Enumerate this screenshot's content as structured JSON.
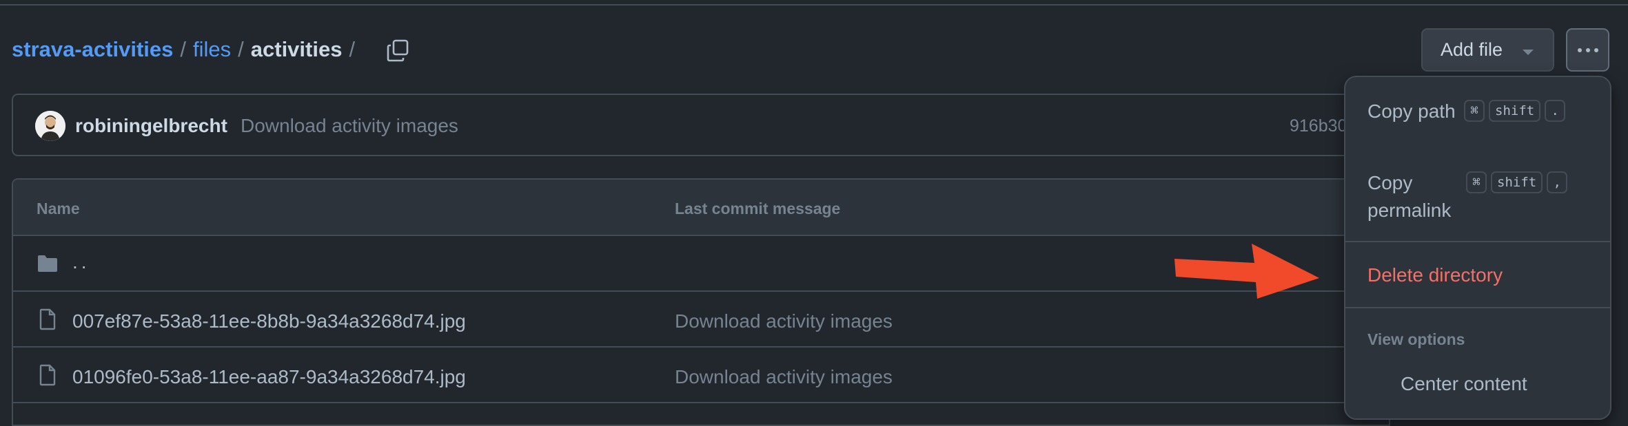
{
  "breadcrumb": {
    "repo": "strava-activities",
    "folder": "files",
    "current": "activities",
    "separator": "/"
  },
  "toolbar": {
    "add_file_label": "Add file",
    "more_icon": "kebab-horizontal-icon",
    "copy_icon": "copy-icon"
  },
  "commit": {
    "author": "robiningelbrecht",
    "message": "Download activity images",
    "hash": "916b30"
  },
  "table": {
    "columns": [
      "Name",
      "Last commit message"
    ],
    "parent_label": "..",
    "rows": [
      {
        "name": "007ef87e-53a8-11ee-8b8b-9a34a3268d74.jpg",
        "message": "Download activity images"
      },
      {
        "name": "01096fe0-53a8-11ee-aa87-9a34a3268d74.jpg",
        "message": "Download activity images"
      }
    ]
  },
  "menu": {
    "copy_path": "Copy path",
    "copy_path_keys": [
      "⌘",
      "shift",
      "."
    ],
    "copy_permalink": "Copy permalink",
    "copy_permalink_keys": [
      "⌘",
      "shift",
      ","
    ],
    "delete_directory": "Delete directory",
    "view_options_header": "View options",
    "center_content": "Center content"
  },
  "colors": {
    "background": "#22272e",
    "link": "#539bf5",
    "danger": "#f47067",
    "annotation_arrow": "#f04a2a"
  }
}
